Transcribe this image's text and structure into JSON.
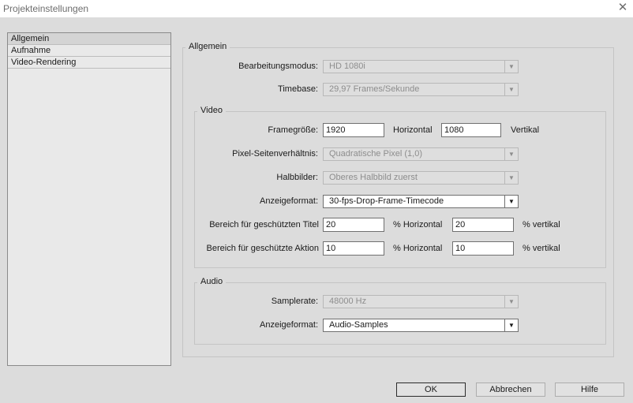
{
  "window": {
    "title": "Projekteinstellungen"
  },
  "sidebar": {
    "items": [
      {
        "label": "Allgemein"
      },
      {
        "label": "Aufnahme"
      },
      {
        "label": "Video-Rendering"
      }
    ]
  },
  "general": {
    "heading": "Allgemein",
    "editing_mode": {
      "label": "Bearbeitungsmodus:",
      "value": "HD 1080i"
    },
    "timebase": {
      "label": "Timebase:",
      "value": "29,97 Frames/Sekunde"
    }
  },
  "video": {
    "heading": "Video",
    "frame_size": {
      "label": "Framegröße:",
      "width": "1920",
      "width_unit": "Horizontal",
      "height": "1080",
      "height_unit": "Vertikal"
    },
    "pixel_aspect": {
      "label": "Pixel-Seitenverhältnis:",
      "value": "Quadratische Pixel (1,0)"
    },
    "fields": {
      "label": "Halbbilder:",
      "value": "Oberes Halbbild zuerst"
    },
    "display_format": {
      "label": "Anzeigeformat:",
      "value": "30-fps-Drop-Frame-Timecode"
    },
    "title_safe": {
      "label": "Bereich für geschützten Titel",
      "h": "20",
      "h_unit": "% Horizontal",
      "v": "20",
      "v_unit": "% vertikal"
    },
    "action_safe": {
      "label": "Bereich für geschützte Aktion",
      "h": "10",
      "h_unit": "% Horizontal",
      "v": "10",
      "v_unit": "% vertikal"
    }
  },
  "audio": {
    "heading": "Audio",
    "sample_rate": {
      "label": "Samplerate:",
      "value": "48000 Hz"
    },
    "display_format": {
      "label": "Anzeigeformat:",
      "value": "Audio-Samples"
    }
  },
  "buttons": {
    "ok": "OK",
    "cancel": "Abbrechen",
    "help": "Hilfe"
  },
  "icons": {
    "close": "close-icon",
    "dropdown": "chevron-down-icon"
  }
}
